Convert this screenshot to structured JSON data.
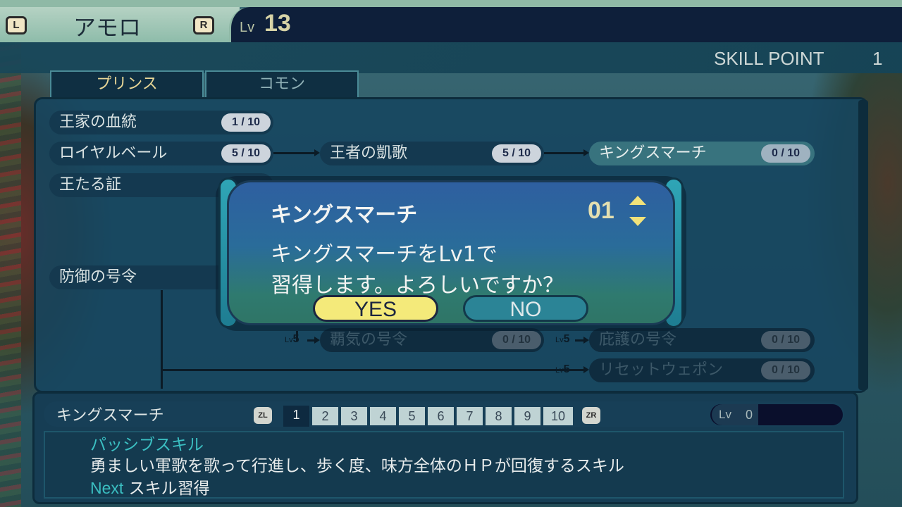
{
  "header": {
    "l_button": "L",
    "r_button": "R",
    "character_name": "アモロ",
    "level_label": "Lv",
    "level_value": "13",
    "skill_point_label": "SKILL POINT",
    "skill_point_value": "1"
  },
  "tabs": [
    {
      "label": "プリンス",
      "active": true
    },
    {
      "label": "コモン",
      "active": false
    }
  ],
  "skill_tree": {
    "row1": {
      "name": "王家の血統",
      "cur": "1",
      "max": "10"
    },
    "row2": [
      {
        "name": "ロイヤルベール",
        "cur": "5",
        "max": "10"
      },
      {
        "name": "王者の凱歌",
        "cur": "5",
        "max": "10"
      },
      {
        "name": "キングスマーチ",
        "cur": "0",
        "max": "10"
      }
    ],
    "row3": {
      "name": "王たる証"
    },
    "row4": {
      "name": "防御の号令"
    },
    "row5": [
      {
        "req_prefix": "Lv",
        "req_level": "5",
        "name": "覇気の号令",
        "cur": "0",
        "max": "10"
      },
      {
        "req_prefix": "Lv",
        "req_level": "5",
        "name": "庇護の号令",
        "cur": "0",
        "max": "10"
      }
    ],
    "row6": {
      "req_prefix": "Lv",
      "req_level": "5",
      "name": "リセットウェポン",
      "cur": "0",
      "max": "10"
    }
  },
  "modal": {
    "title": "キングスマーチ",
    "amount": "01",
    "message_line1": "キングスマーチをLv1で",
    "message_line2": "習得します。よろしいですか？",
    "yes_label": "YES",
    "no_label": "NO"
  },
  "info": {
    "skill_name": "キングスマーチ",
    "zl_label": "ZL",
    "zr_label": "ZR",
    "level_tabs": [
      "1",
      "2",
      "3",
      "4",
      "5",
      "6",
      "7",
      "8",
      "9",
      "10"
    ],
    "active_level_tab": "1",
    "lv_label": "Lv",
    "lv_value": "0",
    "skill_type": "パッシブスキル",
    "description": "勇ましい軍歌を歌って行進し、歩く度、味方全体のＨＰが回復するスキル",
    "next_word": "Next",
    "next_text": "スキル習得"
  },
  "colors": {
    "accent_yellow": "#f4ea7a",
    "accent_cyan": "#3bbfc2",
    "panel_blue": "#164660"
  }
}
